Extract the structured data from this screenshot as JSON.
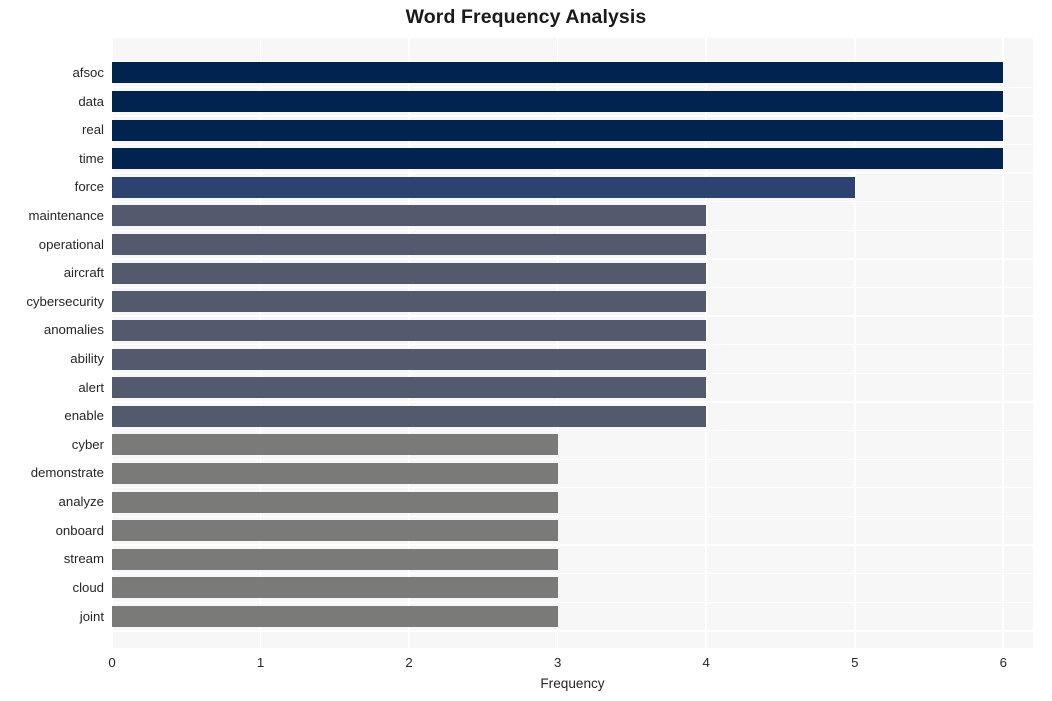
{
  "chart_data": {
    "type": "bar",
    "orientation": "horizontal",
    "title": "Word Frequency Analysis",
    "xlabel": "Frequency",
    "ylabel": "",
    "xlim": [
      0,
      6.2
    ],
    "xticks": [
      0,
      1,
      2,
      3,
      4,
      5,
      6
    ],
    "xtick_labels": [
      "0",
      "1",
      "2",
      "3",
      "4",
      "5",
      "6"
    ],
    "grid": true,
    "grid_color": "#ffffff",
    "plot_background": "#f7f7f7",
    "legend": null,
    "categories": [
      "afsoc",
      "data",
      "real",
      "time",
      "force",
      "maintenance",
      "operational",
      "aircraft",
      "cybersecurity",
      "anomalies",
      "ability",
      "alert",
      "enable",
      "cyber",
      "demonstrate",
      "analyze",
      "onboard",
      "stream",
      "cloud",
      "joint"
    ],
    "values": [
      6,
      6,
      6,
      6,
      5,
      4,
      4,
      4,
      4,
      4,
      4,
      4,
      4,
      3,
      3,
      3,
      3,
      3,
      3,
      3
    ],
    "bar_colors": [
      "#00234f",
      "#00234f",
      "#00234f",
      "#00234f",
      "#2c4270",
      "#545a6e",
      "#545a6e",
      "#545a6e",
      "#545a6e",
      "#545a6e",
      "#545a6e",
      "#545a6e",
      "#545a6e",
      "#7a7a78",
      "#7a7a78",
      "#7a7a78",
      "#7a7a78",
      "#7a7a78",
      "#7a7a78",
      "#7a7a78"
    ],
    "colors": {
      "value_6": "#00234f",
      "value_5": "#2c4270",
      "value_4": "#545a6e",
      "value_3": "#7a7a78",
      "text": "#262626",
      "title": "#1a1a1a",
      "page_background": "#ffffff"
    }
  }
}
